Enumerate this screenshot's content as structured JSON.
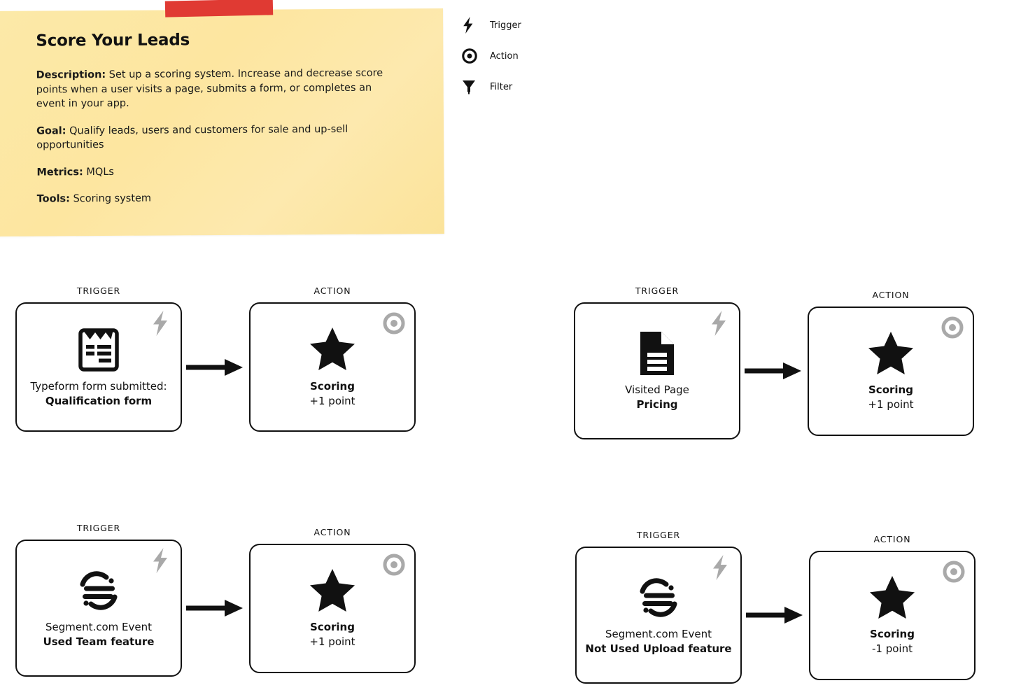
{
  "note": {
    "tape_color": "#e03a33",
    "background_color": "#fce5a0",
    "title": "Score Your Leads",
    "description_label": "Description:",
    "description_text": " Set up a scoring system. Increase and decrease score points when a user visits a page, submits a form, or completes an event in your app.",
    "goal_label": "Goal:",
    "goal_text": " Qualify leads, users and customers for sale and up-sell opportunities",
    "metrics_label": "Metrics:",
    "metrics_text": " MQLs",
    "tools_label": "Tools:",
    "tools_text": " Scoring system"
  },
  "legend": {
    "items": [
      {
        "icon": "lightning-bolt-icon",
        "label": "Trigger"
      },
      {
        "icon": "target-bullseye-icon",
        "label": "Action"
      },
      {
        "icon": "funnel-filter-icon",
        "label": "Filter"
      }
    ]
  },
  "flows": [
    {
      "trigger": {
        "kicker": "TRIGGER",
        "badge": "lightning-bolt-icon",
        "icon": "typeform-clipboard-icon",
        "line1": "Typeform form submitted:",
        "line2": "Qualification form"
      },
      "arrow": "arrow-right-icon",
      "action": {
        "kicker": "ACTION",
        "badge": "target-bullseye-icon",
        "icon": "star-icon",
        "line1": "Scoring",
        "line2": "+1 point"
      }
    },
    {
      "trigger": {
        "kicker": "TRIGGER",
        "badge": "lightning-bolt-icon",
        "icon": "document-page-icon",
        "line1": "Visited Page",
        "line2": "Pricing"
      },
      "arrow": "arrow-right-icon",
      "action": {
        "kicker": "ACTION",
        "badge": "target-bullseye-icon",
        "icon": "star-icon",
        "line1": "Scoring",
        "line2": "+1 point"
      }
    },
    {
      "trigger": {
        "kicker": "TRIGGER",
        "badge": "lightning-bolt-icon",
        "icon": "segment-logo-icon",
        "line1": "Segment.com Event",
        "line2": "Used Team feature"
      },
      "arrow": "arrow-right-icon",
      "action": {
        "kicker": "ACTION",
        "badge": "target-bullseye-icon",
        "icon": "star-icon",
        "line1": "Scoring",
        "line2": "+1 point"
      }
    },
    {
      "trigger": {
        "kicker": "TRIGGER",
        "badge": "lightning-bolt-icon",
        "icon": "segment-logo-icon",
        "line1": "Segment.com Event",
        "line2": "Not Used Upload feature"
      },
      "arrow": "arrow-right-icon",
      "action": {
        "kicker": "ACTION",
        "badge": "target-bullseye-icon",
        "icon": "star-icon",
        "line1": "Scoring",
        "line2": "-1 point"
      }
    }
  ],
  "colors": {
    "badge_gray": "#a9a9a9",
    "stroke_black": "#111111",
    "tape_red": "#e03a33",
    "note_yellow": "#fce5a0"
  }
}
